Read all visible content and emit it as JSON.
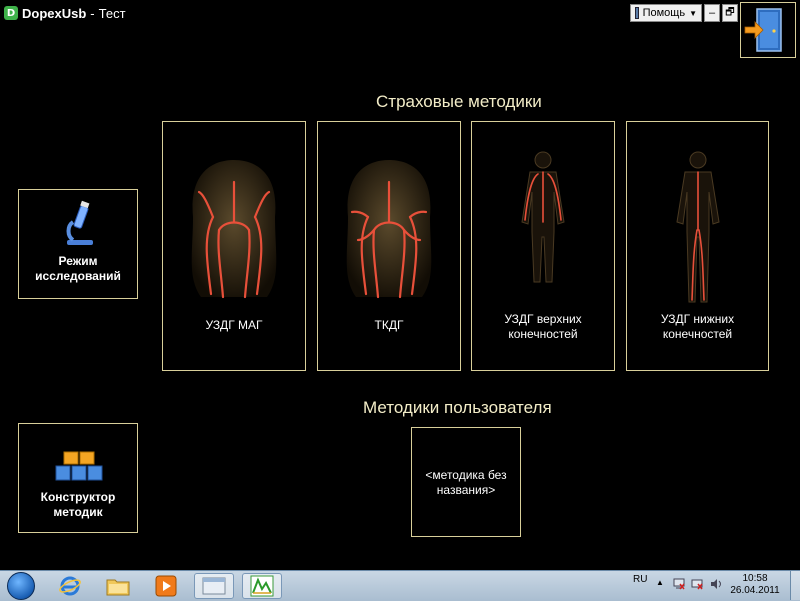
{
  "window": {
    "app_name": "DopexUsb",
    "separator": "-",
    "subtitle": "Тест"
  },
  "toolbar": {
    "help_label": "Помощь",
    "minimize_label": "–",
    "restore_label": "🗗"
  },
  "sections": {
    "standard_title": "Страховые методики",
    "user_title": "Методики пользователя"
  },
  "methods": [
    {
      "label": "УЗДГ МАГ",
      "icon": "head-vessels-icon"
    },
    {
      "label": "ТКДГ",
      "icon": "head-vessels-icon"
    },
    {
      "label": "УЗДГ верхних конечностей",
      "icon": "body-vessels-icon"
    },
    {
      "label": "УЗДГ нижних конечностей",
      "icon": "body-vessels-icon"
    }
  ],
  "user_methods": [
    {
      "label": "<методика без названия>"
    }
  ],
  "sidebar": {
    "research_mode": {
      "label": "Режим исследований",
      "icon": "microscope-icon"
    },
    "constructor": {
      "label": "Конструктор методик",
      "icon": "blocks-icon"
    }
  },
  "taskbar": {
    "apps": [
      "start-orb-icon",
      "ie-icon",
      "folder-icon",
      "media-player-icon",
      "app-window-icon",
      "dopex-icon"
    ],
    "language": "RU",
    "time": "10:58",
    "date": "26.04.2011"
  },
  "colors": {
    "accent_border": "#d8cf9a",
    "vessel": "#e8503a",
    "background": "#000000"
  }
}
